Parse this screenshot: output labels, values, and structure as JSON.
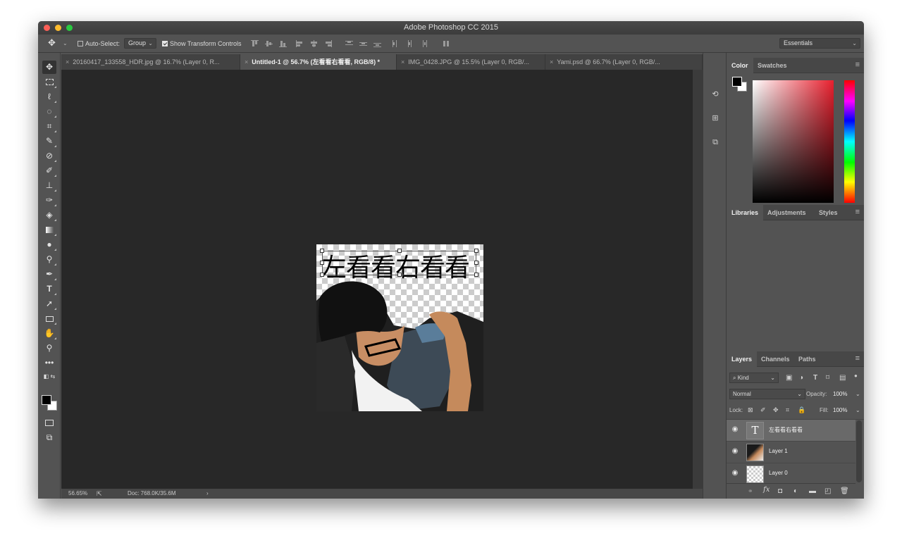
{
  "window": {
    "title": "Adobe Photoshop CC 2015"
  },
  "options_bar": {
    "auto_select_label": "Auto-Select:",
    "auto_select_mode": "Group",
    "show_transform_label": "Show Transform Controls",
    "workspace": "Essentials"
  },
  "tabs": [
    {
      "label": "20160417_133558_HDR.jpg @ 16.7% (Layer 0, R...",
      "active": false
    },
    {
      "label": "Untitled-1 @ 56.7% (左看看右看看, RGB/8) *",
      "active": true
    },
    {
      "label": "IMG_0428.JPG @ 15.5% (Layer 0, RGB/...",
      "active": false
    },
    {
      "label": "Yami.psd @ 66.7% (Layer 0, RGB/...",
      "active": false
    }
  ],
  "tools": [
    "move-tool",
    "marquee-tool",
    "lasso-tool",
    "quick-select-tool",
    "crop-tool",
    "eyedropper-tool",
    "healing-brush-tool",
    "brush-tool",
    "clone-stamp-tool",
    "history-brush-tool",
    "eraser-tool",
    "gradient-tool",
    "blur-tool",
    "dodge-tool",
    "pen-tool",
    "type-tool",
    "path-select-tool",
    "shape-tool",
    "hand-tool",
    "zoom-tool",
    "more-tools"
  ],
  "document": {
    "text_layer_content": "左看看右看看"
  },
  "status": {
    "zoom": "56.65%",
    "doc_size": "Doc: 768.0K/35.6M"
  },
  "panels": {
    "color_tabs": [
      "Color",
      "Swatches"
    ],
    "libraries_tabs": [
      "Libraries",
      "Adjustments",
      "Styles"
    ],
    "layers_tabs": [
      "Layers",
      "Channels",
      "Paths"
    ],
    "filter_kind": "Kind",
    "blend_mode": "Normal",
    "opacity_label": "Opacity:",
    "opacity_value": "100%",
    "lock_label": "Lock:",
    "fill_label": "Fill:",
    "fill_value": "100%"
  },
  "layers": [
    {
      "name": "左看看右看看",
      "type": "text",
      "selected": true
    },
    {
      "name": "Layer 1",
      "type": "image",
      "selected": false
    },
    {
      "name": "Layer 0",
      "type": "transparent",
      "selected": false
    }
  ],
  "colors": {
    "foreground": "#000000",
    "background": "#ffffff",
    "canvas_bg": "#282828",
    "ui_bg": "#535353"
  }
}
